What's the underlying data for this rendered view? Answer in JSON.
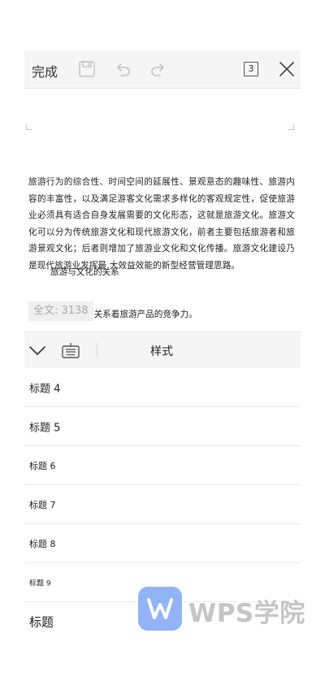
{
  "toolbar": {
    "done_label": "完成",
    "page_count": "3",
    "icons": [
      "save-icon",
      "undo-icon",
      "redo-icon",
      "close-icon"
    ]
  },
  "document": {
    "paragraph": "旅游行为的综合性、时间空间的延展性、景观意态的趣味性、旅游内容的丰富性，以及满足游客文化需求多样化的客观规定性，促使旅游业必须具有适合自身发展需要的文化形态，这就是旅游文化。旅游文化可以分为传统旅游文化和现代旅游文化，前者主要包括旅游者和旅游景观文化；后者则增加了旅游业文化和文化传播。旅游文化建设乃是现代旅游业发挥最  大效益效能的新型经营管理思路。",
    "heading": "旅游与文化的关系",
    "trailing_text": ";关系着旅游产品的竞争力。",
    "word_count": "全文: 3138"
  },
  "style_bar": {
    "title": "样式",
    "icons": [
      "chevron-down-icon",
      "keyboard-icon"
    ]
  },
  "styles": {
    "items": [
      "标题 4",
      "标题 5",
      "标题 6",
      "标题 7",
      "标题 8",
      "标题 9",
      "标题"
    ]
  },
  "watermark": {
    "text": "WPS学院"
  },
  "colors": {
    "toolbar_bg": "#f5f5f5",
    "logo_blue": "#7fa8f6",
    "muted_text": "#a9a9a9"
  }
}
